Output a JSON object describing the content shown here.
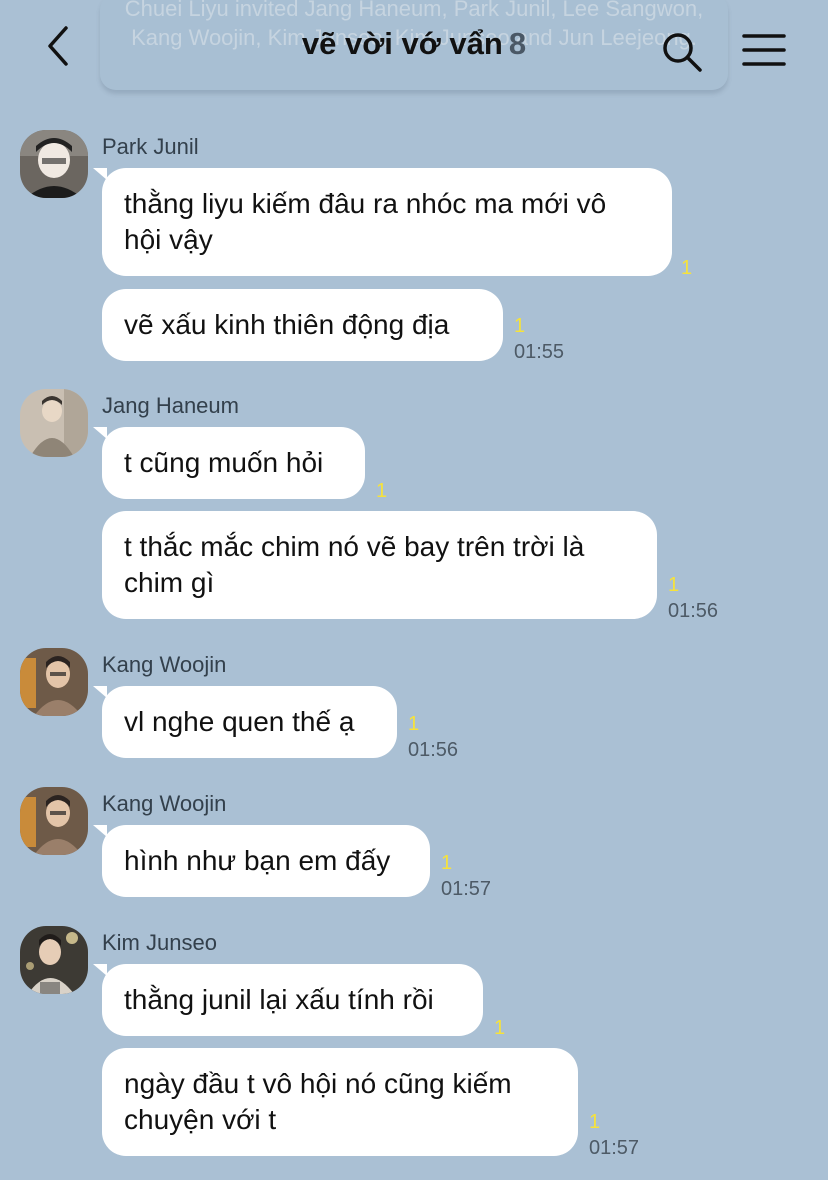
{
  "header": {
    "notice": "Chuei Liyu invited Jang Haneum, Park Junil, Lee Sangwon, Kang Woojin, Kim Junseo, Kim Junseo and Jun Leejeong.",
    "title": "vẽ vời vớ vẩn",
    "member_count": "8",
    "icons": {
      "back": "chevron-left-icon",
      "search": "search-icon",
      "menu": "hamburger-menu-icon"
    }
  },
  "colors": {
    "background": "#aac0d4",
    "bubble": "#ffffff",
    "unread": "#f6e23c",
    "time": "#4d5a66"
  },
  "messages": [
    {
      "sender": "Park Junil",
      "text": "thằng liyu kiếm đâu ra nhóc ma mới vô hội vậy",
      "unread": "1",
      "time": ""
    },
    {
      "sender": "",
      "text": "vẽ xấu kinh thiên động địa",
      "unread": "1",
      "time": "01:55"
    },
    {
      "sender": "Jang Haneum",
      "text": "t cũng muốn hỏi",
      "unread": "1",
      "time": ""
    },
    {
      "sender": "",
      "text": "t thắc mắc chim nó vẽ bay trên trời là chim gì",
      "unread": "1",
      "time": "01:56"
    },
    {
      "sender": "Kang Woojin",
      "text": "vl nghe quen thế ạ",
      "unread": "1",
      "time": "01:56"
    },
    {
      "sender": "Kang Woojin",
      "text": "hình như bạn em đấy",
      "unread": "1",
      "time": "01:57"
    },
    {
      "sender": "Kim Junseo",
      "text": "thằng junil lại xấu tính rồi",
      "unread": "1",
      "time": ""
    },
    {
      "sender": "",
      "text": "ngày đầu t vô hội nó cũng kiếm chuyện với t",
      "unread": "1",
      "time": "01:57"
    }
  ]
}
